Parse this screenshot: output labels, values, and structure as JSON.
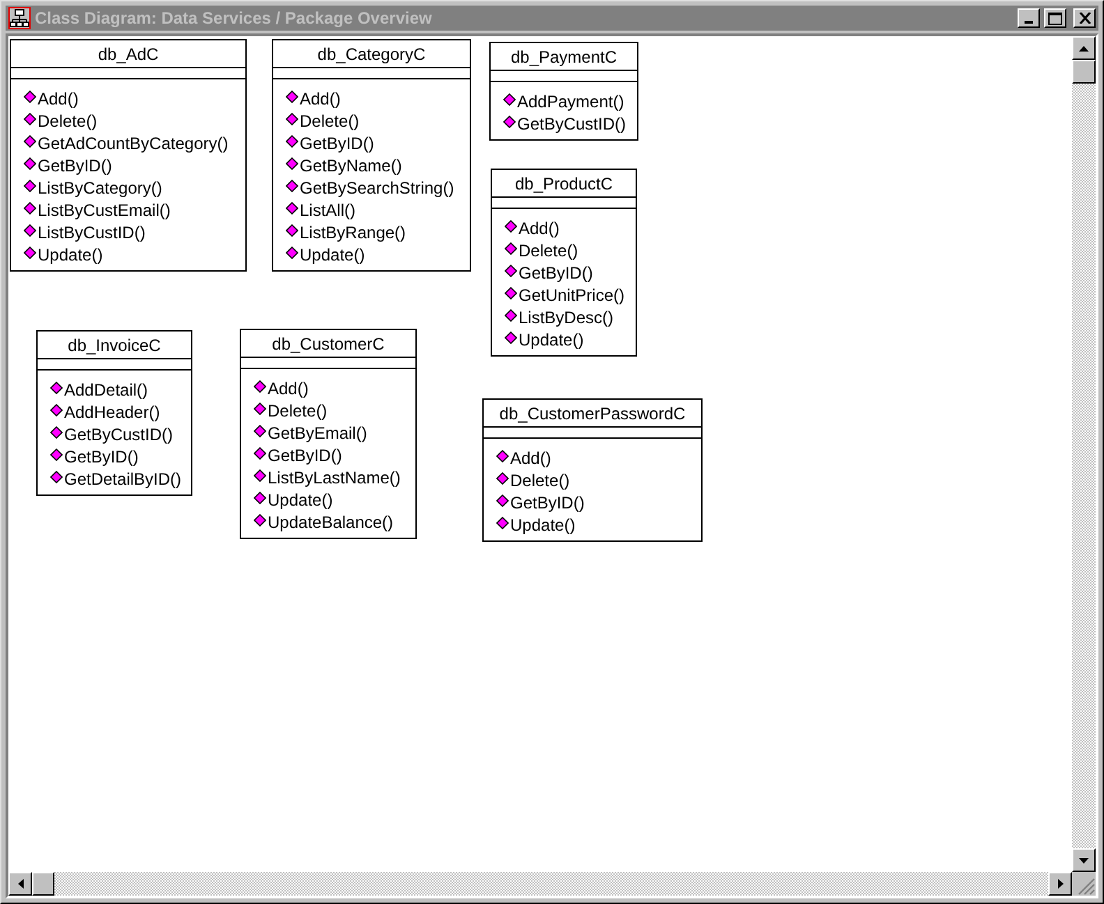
{
  "window": {
    "title": "Class Diagram: Data Services / Package Overview",
    "active": false
  },
  "classes": [
    {
      "name": "db_AdC",
      "operations": [
        "Add()",
        "Delete()",
        "GetAdCountByCategory()",
        "GetByID()",
        "ListByCategory()",
        "ListByCustEmail()",
        "ListByCustID()",
        "Update()"
      ]
    },
    {
      "name": "db_CategoryC",
      "operations": [
        "Add()",
        "Delete()",
        "GetByID()",
        "GetByName()",
        "GetBySearchString()",
        "ListAll()",
        "ListByRange()",
        "Update()"
      ]
    },
    {
      "name": "db_PaymentC",
      "operations": [
        "AddPayment()",
        "GetByCustID()"
      ]
    },
    {
      "name": "db_ProductC",
      "operations": [
        "Add()",
        "Delete()",
        "GetByID()",
        "GetUnitPrice()",
        "ListByDesc()",
        "Update()"
      ]
    },
    {
      "name": "db_InvoiceC",
      "operations": [
        "AddDetail()",
        "AddHeader()",
        "GetByCustID()",
        "GetByID()",
        "GetDetailByID()"
      ]
    },
    {
      "name": "db_CustomerC",
      "operations": [
        "Add()",
        "Delete()",
        "GetByEmail()",
        "GetByID()",
        "ListByLastName()",
        "Update()",
        "UpdateBalance()"
      ]
    },
    {
      "name": "db_CustomerPasswordC",
      "operations": [
        "Add()",
        "Delete()",
        "GetByID()",
        "Update()"
      ]
    }
  ]
}
